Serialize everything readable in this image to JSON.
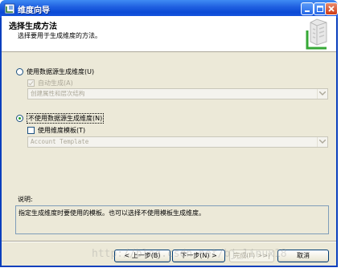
{
  "window": {
    "title": "维度向导",
    "icon": "wizard-icon"
  },
  "header": {
    "title": "选择生成方法",
    "subtitle": "选择要用于生成维度的方法。"
  },
  "options": {
    "use_source": {
      "label": "使用数据源生成维度(U)",
      "selected": false
    },
    "auto_build": {
      "label": "自动生成(A)",
      "checked": true,
      "enabled": false
    },
    "auto_build_combo": {
      "value": "创建属性和层次结构",
      "enabled": false
    },
    "no_source": {
      "label": "不使用数据源生成维度(N)",
      "selected": true
    },
    "use_template": {
      "label": "使用维度模板(T)",
      "checked": false
    },
    "template_combo": {
      "value": "Account Template",
      "enabled": false
    }
  },
  "description": {
    "label": "说明:",
    "text": "指定生成维度时要使用的模板。也可以选择不使用模板生成维度。"
  },
  "buttons": {
    "back": "< 上一步(B)",
    "next": "下一步(N) >",
    "finish": "完成(F) >>|",
    "cancel": "取消"
  },
  "watermark": "http://blog.csdn.net/bj_linux18"
}
